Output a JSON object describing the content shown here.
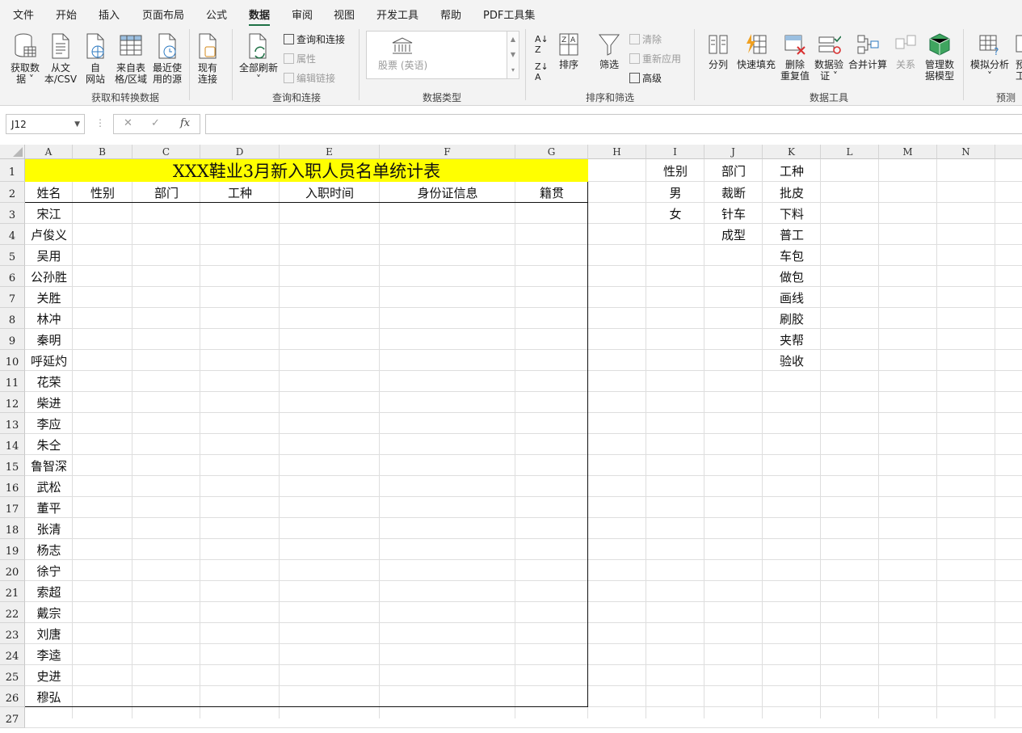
{
  "menu": [
    "文件",
    "开始",
    "插入",
    "页面布局",
    "公式",
    "数据",
    "审阅",
    "视图",
    "开发工具",
    "帮助",
    "PDF工具集"
  ],
  "menu_active": "数据",
  "ribbon": {
    "get_data": {
      "line1": "获取数",
      "line2": "据 ˅"
    },
    "from_csv": {
      "line1": "从文",
      "line2": "本/CSV"
    },
    "from_web": {
      "line1": "自",
      "line2": "网站"
    },
    "from_table": {
      "line1": "来自表",
      "line2": "格/区域"
    },
    "recent_sources": {
      "line1": "最近使",
      "line2": "用的源"
    },
    "existing_conn": {
      "line1": "现有",
      "line2": "连接"
    },
    "group1": "获取和转换数据",
    "refresh_all": {
      "line1": "全部刷新",
      "line2": "˅"
    },
    "queries_conn": "查询和连接",
    "properties": "属性",
    "edit_links": "编辑链接",
    "group2": "查询和连接",
    "stocks": "股票 (英语)",
    "group3": "数据类型",
    "sort": "排序",
    "filter": "筛选",
    "clear": "清除",
    "reapply": "重新应用",
    "advanced": "高级",
    "group4": "排序和筛选",
    "text_to_cols": "分列",
    "flash_fill": "快速填充",
    "remove_dup": {
      "line1": "删除",
      "line2": "重复值"
    },
    "data_valid": {
      "line1": "数据验",
      "line2": "证 ˅"
    },
    "consolidate": "合并计算",
    "relations": "关系",
    "data_model": {
      "line1": "管理数",
      "line2": "据模型"
    },
    "group5": "数据工具",
    "what_if": {
      "line1": "模拟分析",
      "line2": "˅"
    },
    "forecast_partial": {
      "line1": "预",
      "line2": "工"
    },
    "group6": "预测"
  },
  "formula_bar": {
    "name_box": "J12",
    "cancel": "✕",
    "enter": "✓",
    "fx": "fx",
    "content": ""
  },
  "columns": [
    "A",
    "B",
    "C",
    "D",
    "E",
    "F",
    "G",
    "H",
    "I",
    "J",
    "K",
    "L",
    "M",
    "N"
  ],
  "rows": [
    "1",
    "2",
    "3",
    "4",
    "5",
    "6",
    "7",
    "8",
    "9",
    "10",
    "11",
    "12",
    "13",
    "14",
    "15",
    "16",
    "17",
    "18",
    "19",
    "20",
    "21",
    "22",
    "23",
    "24",
    "25",
    "26",
    "27"
  ],
  "title": "XXX鞋业3月新入职人员名单统计表",
  "title_bg": "#ffff00",
  "headers": [
    "姓名",
    "性别",
    "部门",
    "工种",
    "入职时间",
    "身份证信息",
    "籍贯"
  ],
  "names": [
    "宋江",
    "卢俊义",
    "吴用",
    "公孙胜",
    "关胜",
    "林冲",
    "秦明",
    "呼延灼",
    "花荣",
    "柴进",
    "李应",
    "朱仝",
    "鲁智深",
    "武松",
    "董平",
    "张清",
    "杨志",
    "徐宁",
    "索超",
    "戴宗",
    "刘唐",
    "李逵",
    "史进",
    "穆弘"
  ],
  "lists": {
    "gender": [
      "性别",
      "男",
      "女"
    ],
    "dept": [
      "部门",
      "裁断",
      "针车",
      "成型"
    ],
    "job": [
      "工种",
      "批皮",
      "下料",
      "普工",
      "车包",
      "做包",
      "画线",
      "刷胶",
      "夹帮",
      "验收"
    ]
  },
  "colors": {
    "accent": "#1e7145",
    "ribbon_bg": "#f3f3f3"
  }
}
